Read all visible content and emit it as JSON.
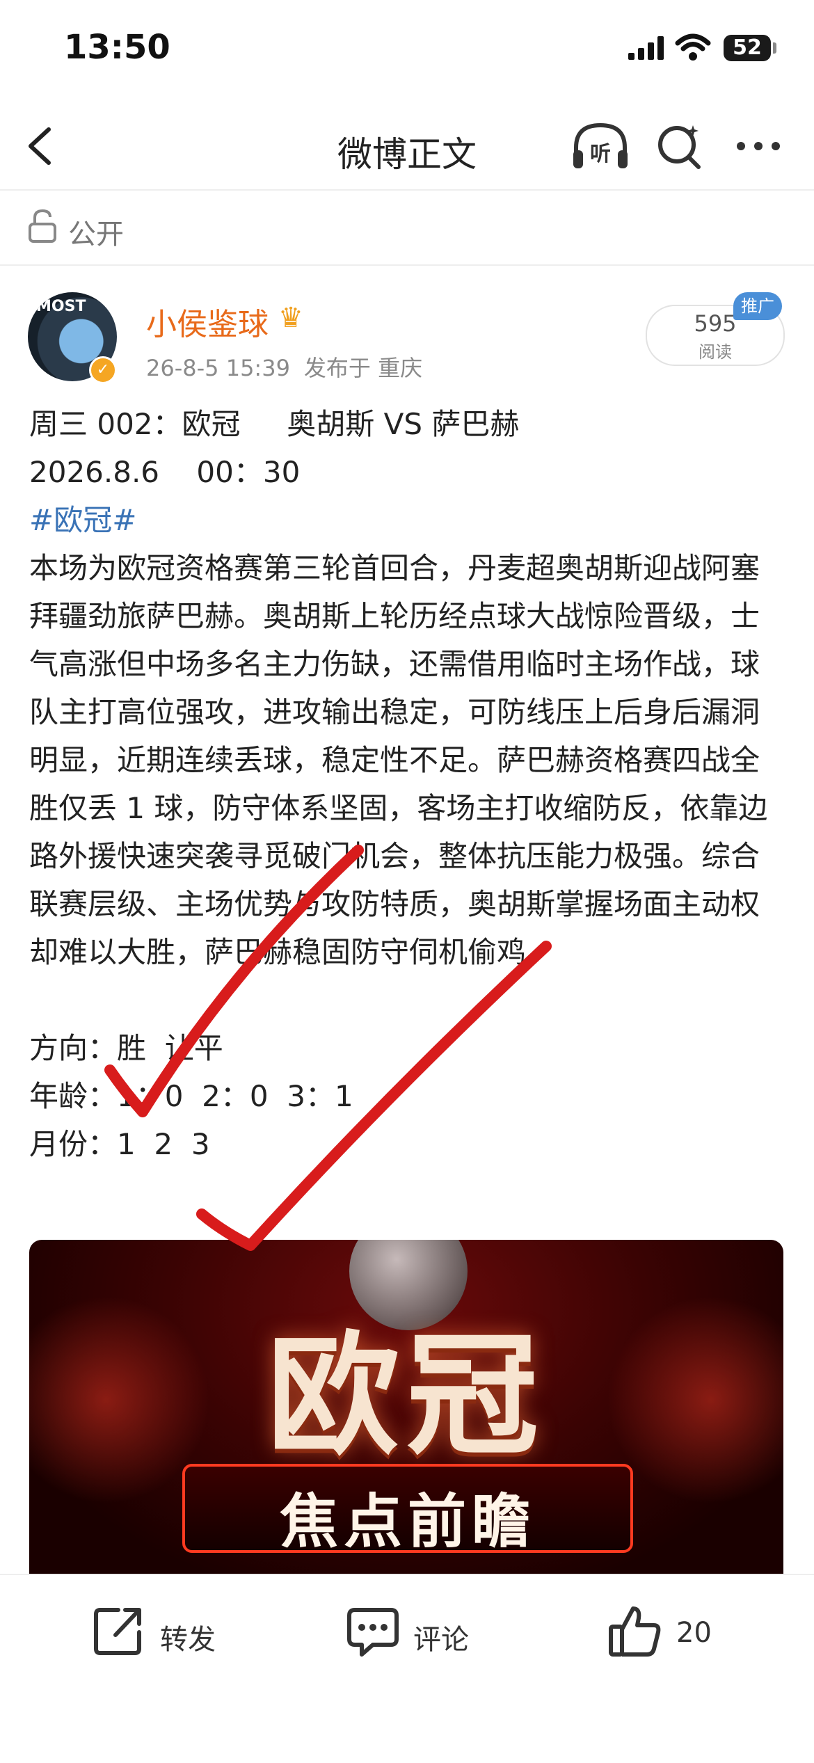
{
  "status_bar": {
    "time": "13:50",
    "battery": "52"
  },
  "nav": {
    "title": "微博正文",
    "listen_label": "听"
  },
  "visibility": {
    "label": "公开"
  },
  "post": {
    "author": "小侯鉴球",
    "avatar_text": "MOST",
    "timestamp": "26-8-5 15:39",
    "location_text": "发布于 重庆",
    "read_count": "595",
    "read_label": "阅读",
    "promo_badge": "推广",
    "lines": {
      "match": "周三 002：欧冠     奥胡斯 VS 萨巴赫",
      "datetime": "2026.8.6    00：30",
      "hashtag": "#欧冠#",
      "body": "本场为欧冠资格赛第三轮首回合，丹麦超奥胡斯迎战阿塞拜疆劲旅萨巴赫。奥胡斯上轮历经点球大战惊险晋级，士气高涨但中场多名主力伤缺，还需借用临时主场作战，球队主打高位强攻，进攻输出稳定，可防线压上后身后漏洞明显，近期连续丢球，稳定性不足。萨巴赫资格赛四战全胜仅丢 1 球，防守体系坚固，客场主打收缩防反，依靠边路外援快速突袭寻觅破门机会，整体抗压能力极强。综合联赛层级、主场优势与攻防特质，奥胡斯掌握场面主动权却难以大胜，萨巴赫稳固防守伺机偷鸡",
      "direction": "方向：胜  让平",
      "age": "年龄：1：0  2：0  3：1",
      "month": "月份：1  2  3"
    },
    "banner": {
      "title": "欧冠",
      "subtitle": "焦点前瞻"
    }
  },
  "actions": {
    "repost": "转发",
    "comment": "评论",
    "like_count": "20"
  }
}
